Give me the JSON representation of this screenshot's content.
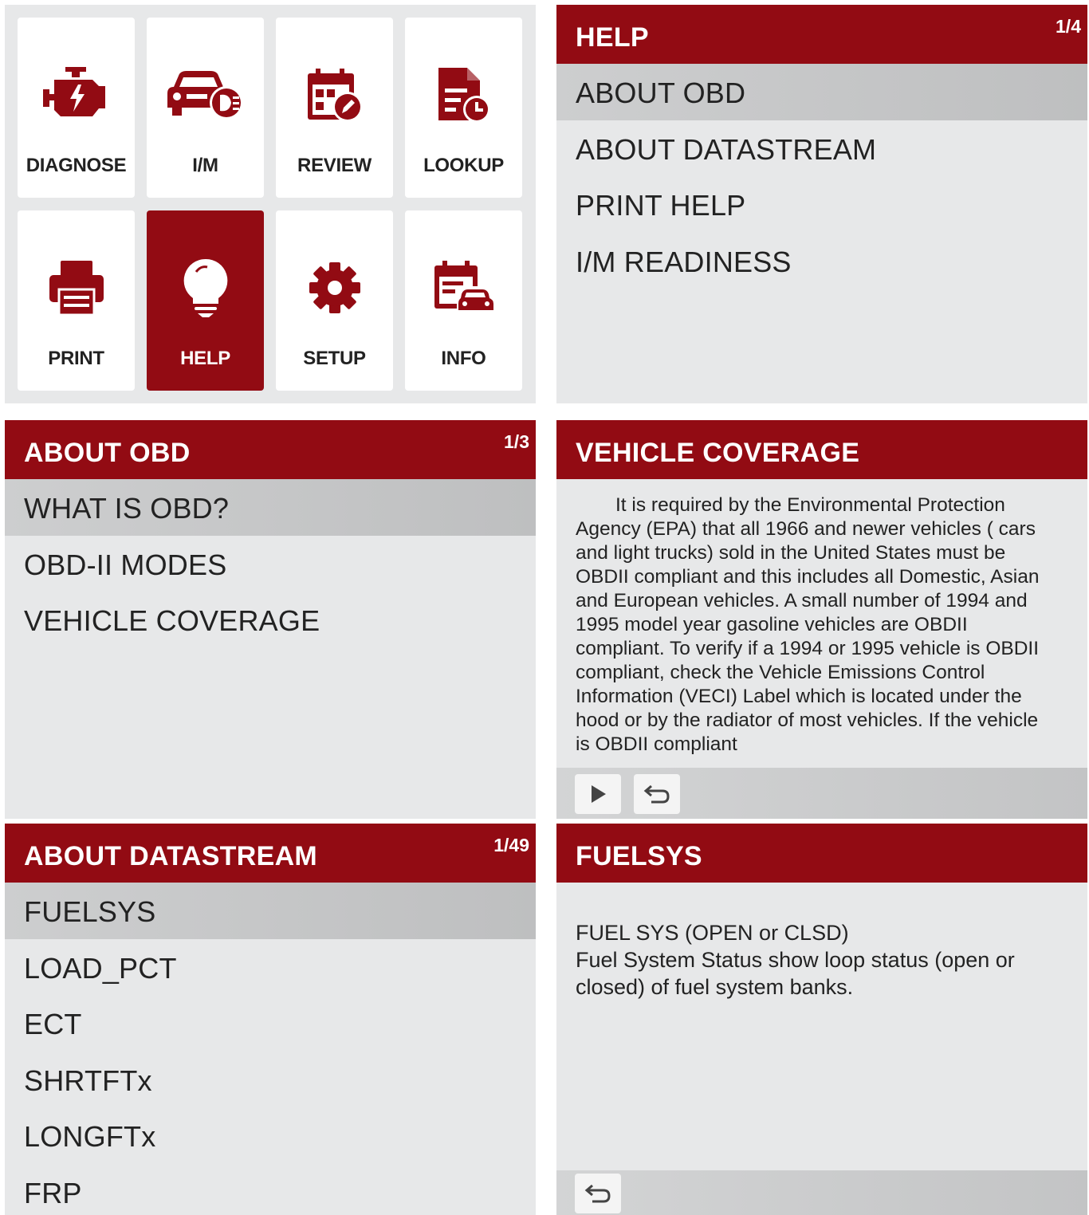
{
  "main_menu": {
    "tiles": [
      {
        "label": "DIAGNOSE",
        "icon": "engine-icon"
      },
      {
        "label": "I/M",
        "icon": "car-readiness-icon"
      },
      {
        "label": "REVIEW",
        "icon": "calendar-edit-icon"
      },
      {
        "label": "LOOKUP",
        "icon": "document-clock-icon"
      },
      {
        "label": "PRINT",
        "icon": "printer-icon"
      },
      {
        "label": "HELP",
        "icon": "lightbulb-icon",
        "selected": true
      },
      {
        "label": "SETUP",
        "icon": "gear-icon"
      },
      {
        "label": "INFO",
        "icon": "calendar-car-icon"
      }
    ]
  },
  "help_menu": {
    "title": "HELP",
    "page": "1/4",
    "items": [
      "ABOUT OBD",
      "ABOUT DATASTREAM",
      "PRINT HELP",
      "I/M READINESS"
    ]
  },
  "about_obd": {
    "title": "ABOUT OBD",
    "page": "1/3",
    "items": [
      "WHAT IS OBD?",
      "OBD-II MODES",
      "VEHICLE COVERAGE"
    ]
  },
  "vehicle_coverage": {
    "title": "VEHICLE COVERAGE",
    "text": "It is required by the Environmental Protection Agency (EPA) that all 1966 and newer vehicles ( cars and light trucks) sold in the United States must be OBDII compliant and this includes all Domestic, Asian and European vehicles. A small number of 1994 and 1995 model year gasoline vehicles are OBDII compliant. To verify if a 1994 or 1995 vehicle is OBDII compliant, check the Vehicle Emissions Control Information (VECI) Label which is located under the hood or by the radiator of most vehicles. If the vehicle is OBDII compliant"
  },
  "about_datastream": {
    "title": "ABOUT DATASTREAM",
    "page": "1/49",
    "items": [
      "FUELSYS",
      "LOAD_PCT",
      "ECT",
      "SHRTFTx",
      "LONGFTx",
      "FRP"
    ]
  },
  "fuelsys": {
    "title": "FUELSYS",
    "line1": "FUEL SYS (OPEN or CLSD)",
    "line2": "Fuel System Status show loop status (open or closed) of fuel system banks."
  },
  "colors": {
    "brand_red": "#920b13",
    "panel_bg": "#e7e8e9",
    "selection": "#c5c6c7"
  }
}
